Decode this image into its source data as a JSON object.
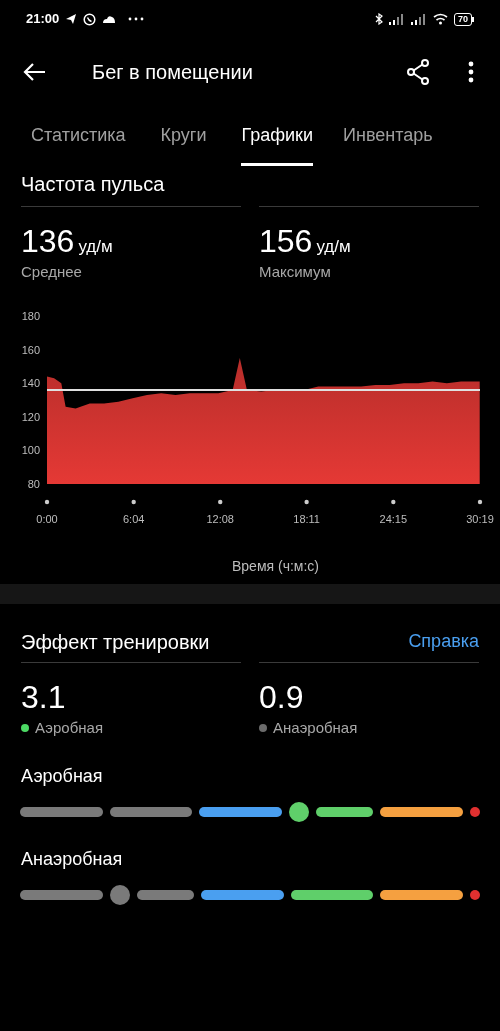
{
  "status_bar": {
    "time": "21:00",
    "battery": "70"
  },
  "header": {
    "title": "Бег в помещении"
  },
  "tabs": [
    {
      "label": "Статистика",
      "selected": false
    },
    {
      "label": "Круги",
      "selected": false
    },
    {
      "label": "Графики",
      "selected": true
    },
    {
      "label": "Инвентарь",
      "selected": false
    }
  ],
  "heart_rate": {
    "title": "Частота пульса",
    "metrics": [
      {
        "value": "136",
        "unit": "уд/м",
        "label": "Среднее"
      },
      {
        "value": "156",
        "unit": "уд/м",
        "label": "Максимум"
      }
    ],
    "chart_data": {
      "type": "area",
      "xlabel": "Время (ч:м:с)",
      "x": [
        0,
        0.5,
        1,
        1.3,
        2,
        3,
        4,
        5,
        6,
        7,
        8,
        9,
        10,
        11,
        12,
        13,
        13.5,
        14,
        15,
        16,
        17,
        18,
        19,
        20,
        21,
        22,
        23,
        24,
        25,
        26,
        27,
        28,
        29,
        30.3
      ],
      "series": [
        {
          "color": "#e53935",
          "values": [
            144,
            143,
            140,
            126,
            125,
            128,
            128,
            129,
            131,
            133,
            134,
            133,
            134,
            134,
            134,
            136,
            155,
            136,
            135,
            136,
            136,
            136,
            138,
            138,
            138,
            138,
            139,
            139,
            140,
            140,
            141,
            140,
            141,
            141
          ]
        }
      ],
      "xlim": [
        0,
        30.32
      ],
      "ylim": [
        80,
        180
      ],
      "xticks": [
        {
          "value": 0,
          "label": "0:00"
        },
        {
          "value": 6.07,
          "label": "6:04"
        },
        {
          "value": 12.13,
          "label": "12:08"
        },
        {
          "value": 18.18,
          "label": "18:11"
        },
        {
          "value": 24.25,
          "label": "24:15"
        },
        {
          "value": 30.32,
          "label": "30:19"
        }
      ],
      "yticks": [
        80,
        100,
        120,
        140,
        160,
        180
      ],
      "ref_lines": [
        {
          "axis": "y",
          "value": 136
        }
      ]
    }
  },
  "training_effect": {
    "title": "Эффект тренировки",
    "help_link": "Справка",
    "metrics": [
      {
        "value": "3.1",
        "label": "Аэробная",
        "color": "#4cd964"
      },
      {
        "value": "0.9",
        "label": "Анаэробная",
        "color": "#6b6b6b"
      }
    ],
    "scales": [
      {
        "label": "Аэробная",
        "segments": [
          {
            "color": "#7a7a7a",
            "marker": false
          },
          {
            "color": "#7a7a7a",
            "marker": false
          },
          {
            "color": "#4a9ff0",
            "marker": false
          },
          {
            "color": "#5fcf6a",
            "marker": true
          },
          {
            "color": "#f5a040",
            "marker": false
          },
          {
            "color": "#e03030",
            "marker": false
          }
        ]
      },
      {
        "label": "Анаэробная",
        "segments": [
          {
            "color": "#7a7a7a",
            "marker": false
          },
          {
            "color": "#7a7a7a",
            "marker": true
          },
          {
            "color": "#4a9ff0",
            "marker": false
          },
          {
            "color": "#5fcf6a",
            "marker": false
          },
          {
            "color": "#f5a040",
            "marker": false
          },
          {
            "color": "#e03030",
            "marker": false
          }
        ]
      }
    ]
  }
}
